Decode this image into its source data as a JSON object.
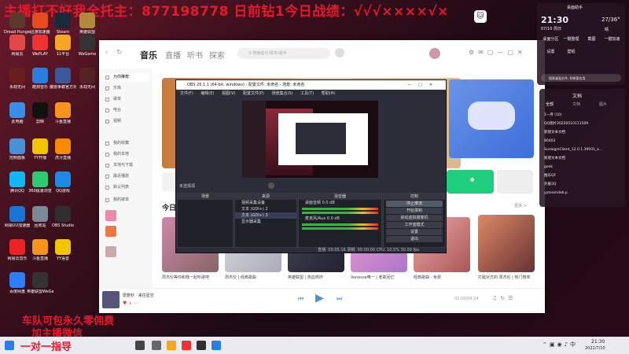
{
  "banner": "主播打不好我全托主：877198778 日前钻1今日战绩：√√√××××√×",
  "desktop_icons": [
    {
      "label": "Dread Hunger",
      "color": "#5b3a2a"
    },
    {
      "label": "迅游加速器",
      "color": "#e84c1e"
    },
    {
      "label": "Steam",
      "color": "#1b2838"
    },
    {
      "label": "英雄联盟",
      "color": "#b08a3a"
    },
    {
      "label": "网易云",
      "color": "#e24848"
    },
    {
      "label": "WePLAY",
      "color": "#e33"
    },
    {
      "label": "11平台",
      "color": "#f5a623"
    },
    {
      "label": "WeGame",
      "color": "#333"
    },
    {
      "label": "永劫无间",
      "color": "#6a1d1d"
    },
    {
      "label": "酷狗音乐",
      "color": "#2a7de1"
    },
    {
      "label": "魔兽争霸官方对战",
      "color": "#3b5998"
    },
    {
      "label": "永劫无间",
      "color": "#552222"
    },
    {
      "label": "此电脑",
      "color": "#3a8ee6"
    },
    {
      "label": "剪映",
      "color": "#111"
    },
    {
      "label": "斗鱼直播",
      "color": "#f7941d"
    },
    {
      "label": "控制面板",
      "color": "#4a90d9"
    },
    {
      "label": "YY开播",
      "color": "#f5c400"
    },
    {
      "label": "虎牙直播",
      "color": "#f58c00"
    },
    {
      "label": "腾讯QQ",
      "color": "#12b7f5"
    },
    {
      "label": "360极速浏览",
      "color": "#2ecc71"
    },
    {
      "label": "QQ游戏",
      "color": "#1e88e5"
    },
    {
      "label": "网易UU加速器",
      "color": "#1976d2"
    },
    {
      "label": "回收站",
      "color": "#7a8a9a"
    },
    {
      "label": "OBS Studio",
      "color": "#302e31"
    },
    {
      "label": "网易云音乐",
      "color": "#e22"
    },
    {
      "label": "斗鱼直播",
      "color": "#f7941d"
    },
    {
      "label": "YY语音",
      "color": "#f5c400"
    },
    {
      "label": "百度网盘",
      "color": "#2e7cf6"
    },
    {
      "label": "英雄联盟WeGame",
      "color": "#333"
    }
  ],
  "promo": {
    "line1": "车队可包永久零佣费",
    "line2": "加主播微信",
    "line3": "一对一指导"
  },
  "app": {
    "tabs": [
      "音乐",
      "直播",
      "听书",
      "探索"
    ],
    "search_placeholder": "Q 搜索音乐/歌单/歌手",
    "sidebar": [
      "为你推荐",
      "乐库",
      "歌单",
      "电台",
      "视频",
      "我的收藏",
      "我的本地",
      "本地与下载",
      "最近播放",
      "默认列表",
      "我的歌单"
    ],
    "section_today": "今日",
    "song_cards": [
      "周杰伦等你和我一起听歌吧",
      "周杰伦 | 经典歌曲",
      "英雄联盟 | 热血燃炸",
      "Vanessa唯一 | 老歌回忆",
      "经典歌曲 - 免费",
      "打敌对方的 周杰伦 | 热门榜单"
    ],
    "player": {
      "title": "斑数秒 · 来往星空",
      "time": "02:00/04:24"
    },
    "playlist_title": "歌单",
    "more_label": "更多 >"
  },
  "obs": {
    "title": "OBS 26.1.1 (64-bit, windows) - 配置文件: 未命名 - 场景: 未命名",
    "menu": [
      "文件(F)",
      "编辑(E)",
      "视图(V)",
      "配置文件(P)",
      "场景集合(S)",
      "工具(T)",
      "帮助(H)"
    ],
    "docks": {
      "scenes": "场景",
      "sources": "来源",
      "mixer": "混音器",
      "transitions": "转场特效",
      "controls": "控制"
    },
    "sources": [
      "视频采集设备",
      "文本 (GDI+) 2",
      "文本 (GDI+) 3",
      "显示器采集"
    ],
    "mixer": [
      {
        "name": "桌面音频",
        "level": "0.0 dB"
      },
      {
        "name": "麦克风/Aux",
        "level": "0.0 dB"
      }
    ],
    "transition": "淡出(淡入)",
    "controls": [
      "停止推流",
      "开始录制",
      "启动虚拟摄像机",
      "工作室模式",
      "设置",
      "退出"
    ],
    "status": "直播: 00:05:16  录制: 00:00:00  CPU: 10.5%  30.00 fps",
    "no_source": "未选择源"
  },
  "widgets": {
    "time": "21:30",
    "date": "07/10 周日",
    "weather": "27/36°",
    "weather_desc": "晴",
    "quick": [
      "桌面助手",
      "桌面分区",
      "一键整理",
      "截图",
      "一键加速",
      "设置",
      "壁纸"
    ],
    "search_placeholder": "搜索桌面文件, 秒收索应用",
    "file_tab_title": "文档",
    "file_tabs": [
      "全部",
      "文档",
      "图片"
    ],
    "files": [
      "1一月 (10)",
      "QQ图片20220510111509",
      "新建文本文档",
      "80403",
      "SunloginClient_12.0.1.39931_x...",
      "新建文本文档",
      "geek",
      "推乐QF",
      "外服3Q",
      "yyteamdeb.p"
    ]
  },
  "taskbar": {
    "time": "21:30",
    "date": "2022/7/10"
  },
  "colors": {
    "accent_green": "#1ece7c",
    "banner_red": "#e8182c"
  }
}
